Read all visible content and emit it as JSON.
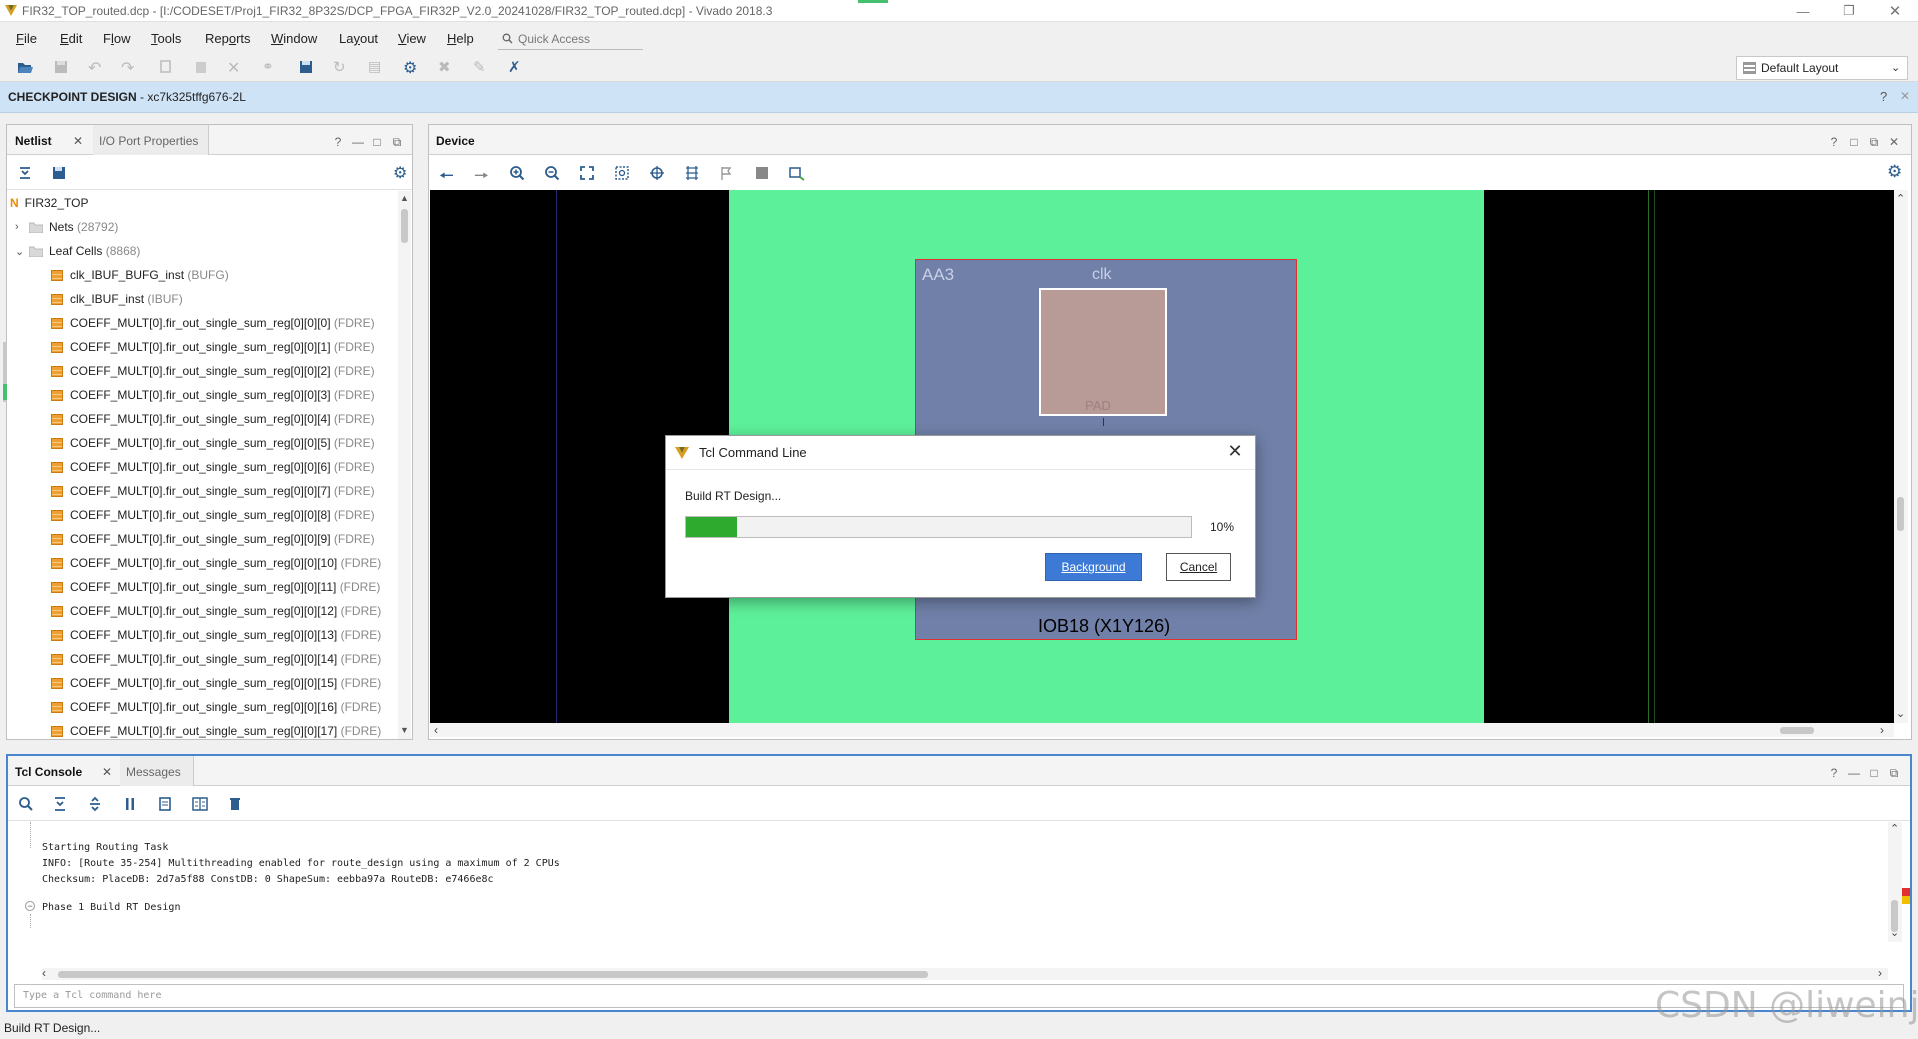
{
  "window": {
    "title": "FIR32_TOP_routed.dcp - [I:/CODESET/Proj1_FIR32_8P32S/DCP_FPGA_FIR32P_V2.0_20241028/FIR32_TOP_routed.dcp] - Vivado 2018.3",
    "controls": [
      "minimize-icon",
      "restore-icon",
      "close-icon"
    ]
  },
  "menu": {
    "items": [
      {
        "pre": "",
        "ul": "F",
        "post": "ile"
      },
      {
        "pre": "",
        "ul": "E",
        "post": "dit"
      },
      {
        "pre": "F",
        "ul": "l",
        "post": "ow"
      },
      {
        "pre": "",
        "ul": "T",
        "post": "ools"
      },
      {
        "pre": "Rep",
        "ul": "o",
        "post": "rts"
      },
      {
        "pre": "",
        "ul": "W",
        "post": "indow"
      },
      {
        "pre": "La",
        "ul": "y",
        "post": "out"
      },
      {
        "pre": "",
        "ul": "V",
        "post": "iew"
      },
      {
        "pre": "",
        "ul": "H",
        "post": "elp"
      }
    ],
    "quick_access_placeholder": "Quick Access"
  },
  "toolbar": {
    "layout_select": "Default Layout"
  },
  "banner": {
    "label": "CHECKPOINT DESIGN",
    "part": " - xc7k325tffg676-2L"
  },
  "netlist_panel": {
    "tabs": [
      "Netlist",
      "I/O Port Properties"
    ],
    "root": "FIR32_TOP",
    "nets_label": "Nets",
    "nets_count": "(28792)",
    "leaf_label": "Leaf Cells",
    "leaf_count": "(8868)",
    "cells": [
      {
        "name": "clk_IBUF_BUFG_inst",
        "type": "(BUFG)"
      },
      {
        "name": "clk_IBUF_inst",
        "type": "(IBUF)"
      },
      {
        "name": "COEFF_MULT[0].fir_out_single_sum_reg[0][0][0]",
        "type": "(FDRE)"
      },
      {
        "name": "COEFF_MULT[0].fir_out_single_sum_reg[0][0][1]",
        "type": "(FDRE)"
      },
      {
        "name": "COEFF_MULT[0].fir_out_single_sum_reg[0][0][2]",
        "type": "(FDRE)"
      },
      {
        "name": "COEFF_MULT[0].fir_out_single_sum_reg[0][0][3]",
        "type": "(FDRE)"
      },
      {
        "name": "COEFF_MULT[0].fir_out_single_sum_reg[0][0][4]",
        "type": "(FDRE)"
      },
      {
        "name": "COEFF_MULT[0].fir_out_single_sum_reg[0][0][5]",
        "type": "(FDRE)"
      },
      {
        "name": "COEFF_MULT[0].fir_out_single_sum_reg[0][0][6]",
        "type": "(FDRE)"
      },
      {
        "name": "COEFF_MULT[0].fir_out_single_sum_reg[0][0][7]",
        "type": "(FDRE)"
      },
      {
        "name": "COEFF_MULT[0].fir_out_single_sum_reg[0][0][8]",
        "type": "(FDRE)"
      },
      {
        "name": "COEFF_MULT[0].fir_out_single_sum_reg[0][0][9]",
        "type": "(FDRE)"
      },
      {
        "name": "COEFF_MULT[0].fir_out_single_sum_reg[0][0][10]",
        "type": "(FDRE)"
      },
      {
        "name": "COEFF_MULT[0].fir_out_single_sum_reg[0][0][11]",
        "type": "(FDRE)"
      },
      {
        "name": "COEFF_MULT[0].fir_out_single_sum_reg[0][0][12]",
        "type": "(FDRE)"
      },
      {
        "name": "COEFF_MULT[0].fir_out_single_sum_reg[0][0][13]",
        "type": "(FDRE)"
      },
      {
        "name": "COEFF_MULT[0].fir_out_single_sum_reg[0][0][14]",
        "type": "(FDRE)"
      },
      {
        "name": "COEFF_MULT[0].fir_out_single_sum_reg[0][0][15]",
        "type": "(FDRE)"
      },
      {
        "name": "COEFF_MULT[0].fir_out_single_sum_reg[0][0][16]",
        "type": "(FDRE)"
      },
      {
        "name": "COEFF_MULT[0].fir_out_single_sum_reg[0][0][17]",
        "type": "(FDRE)"
      }
    ]
  },
  "device_panel": {
    "title": "Device",
    "site_label": "AA3",
    "pad_net": "clk",
    "pad_label": "PAD",
    "iob_label": "IOB18 (X1Y126)"
  },
  "console_panel": {
    "tabs": [
      "Tcl Console",
      "Messages"
    ],
    "lines": [
      "Starting Routing Task",
      "INFO: [Route 35-254] Multithreading enabled for route_design using a maximum of 2 CPUs",
      "Checksum: PlaceDB: 2d7a5f88 ConstDB: 0 ShapeSum: eebba97a RouteDB: e7466e8c",
      "",
      "Phase 1 Build RT Design"
    ],
    "input_placeholder": "Type a Tcl command here"
  },
  "dialog": {
    "title": "Tcl Command Line",
    "message": "Build RT Design...",
    "progress": 0.1,
    "percent_text": "10%",
    "background_button": "Background",
    "cancel_button": "Cancel"
  },
  "status": {
    "text": "Build RT Design..."
  },
  "watermark": "CSDN @liweinjit",
  "colors": {
    "accent": "#3d7ad6",
    "progress": "#2eaa2e",
    "device_bg": "#5df09a",
    "iob_block": "#7080a8",
    "pad": "#b89a96",
    "banner": "#cfe3f7"
  }
}
